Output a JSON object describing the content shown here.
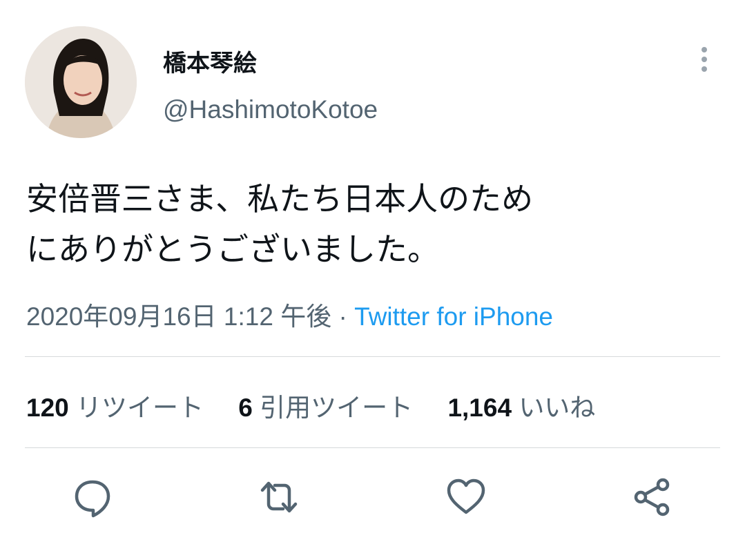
{
  "author": {
    "display_name": "橋本琴絵",
    "handle": "@HashimotoKotoe",
    "avatar_icon": "profile-photo"
  },
  "tweet": {
    "text_line1": "安倍晋三さま、私たち日本人のため",
    "text_line2": "にありがとうございました。",
    "timestamp": "2020年09月16日 1:12 午後",
    "separator": "·",
    "source": "Twitter for iPhone"
  },
  "stats": {
    "retweets_count": "120",
    "retweets_label": "リツイート",
    "quotes_count": "6",
    "quotes_label": "引用ツイート",
    "likes_count": "1,164",
    "likes_label": "いいね"
  },
  "actions": {
    "reply_icon": "speech-bubble-icon",
    "retweet_icon": "retweet-icon",
    "like_icon": "heart-icon",
    "share_icon": "share-icon"
  },
  "colors": {
    "text": "#0f1419",
    "secondary": "#536471",
    "accent": "#1d9bf0",
    "divider": "#d6d9db"
  }
}
